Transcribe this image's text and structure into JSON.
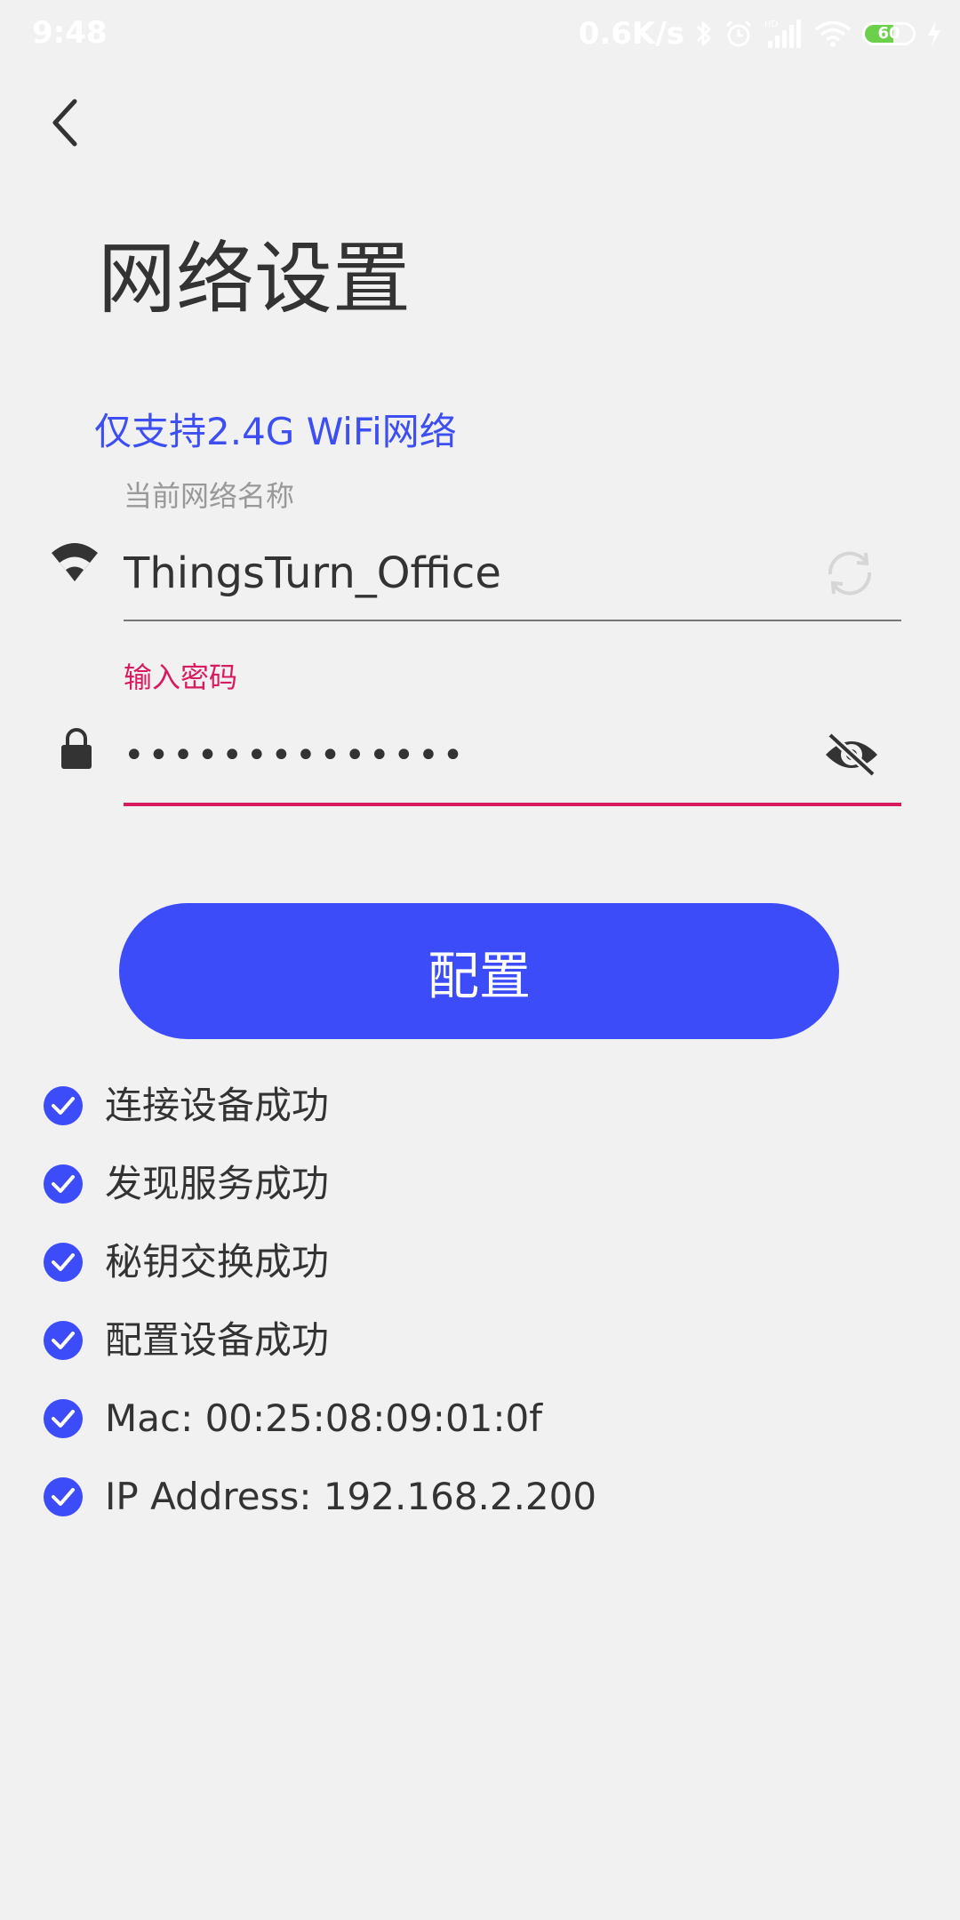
{
  "status_bar": {
    "time": "9:48",
    "net_speed": "0.6K/s",
    "battery_level": "60",
    "icons": [
      "bluetooth-icon",
      "alarm-icon",
      "hd-signal-icon",
      "wifi-icon",
      "battery-icon",
      "charging-icon"
    ]
  },
  "header": {
    "back_icon": "chevron-left-icon",
    "title": "网络设置"
  },
  "form": {
    "hint": "仅支持2.4G WiFi网络",
    "ssid": {
      "label": "当前网络名称",
      "value": "ThingsTurn_Office",
      "icon": "wifi-icon",
      "action_icon": "refresh-icon"
    },
    "password": {
      "label": "输入密码",
      "value": "••••••••••••••",
      "icon": "lock-icon",
      "action_icon": "visibility-off-icon"
    },
    "submit_label": "配置"
  },
  "progress": {
    "items": [
      {
        "text": "连接设备成功",
        "done": true
      },
      {
        "text": "发现服务成功",
        "done": true
      },
      {
        "text": "秘钥交换成功",
        "done": true
      },
      {
        "text": "配置设备成功",
        "done": true
      },
      {
        "text": "Mac: 00:25:08:09:01:0f",
        "done": true
      },
      {
        "text": "IP Address: 192.168.2.200",
        "done": true
      }
    ]
  },
  "colors": {
    "accent": "#3b4cf8",
    "hint": "#3d4ef2",
    "error_pink": "#d81b60",
    "battery_green": "#6cd14a"
  }
}
